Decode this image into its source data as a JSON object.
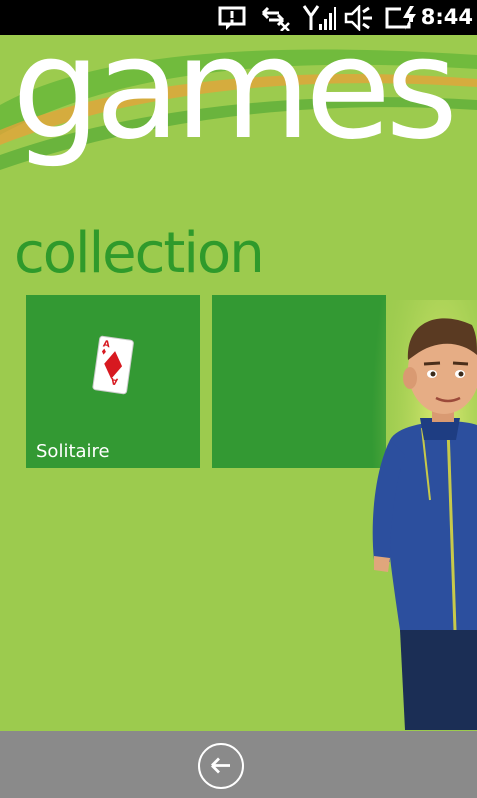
{
  "status_bar": {
    "time": "8:44",
    "icons": [
      "message-icon",
      "data-transfer-icon",
      "signal-icon",
      "volume-icon",
      "battery-charging-icon"
    ]
  },
  "hub": {
    "title": "games",
    "section_title": "collection"
  },
  "tiles": [
    {
      "label": "Solitaire",
      "icon": "playing-card-icon"
    },
    {
      "label": "",
      "icon": ""
    }
  ],
  "app_bar": {
    "back_icon": "back-arrow-icon"
  },
  "colors": {
    "background": "#9ccb4e",
    "tile": "#339933",
    "section_title": "#2f9a2b",
    "status_bar": "#000000",
    "app_bar": "#8a8a8a"
  }
}
